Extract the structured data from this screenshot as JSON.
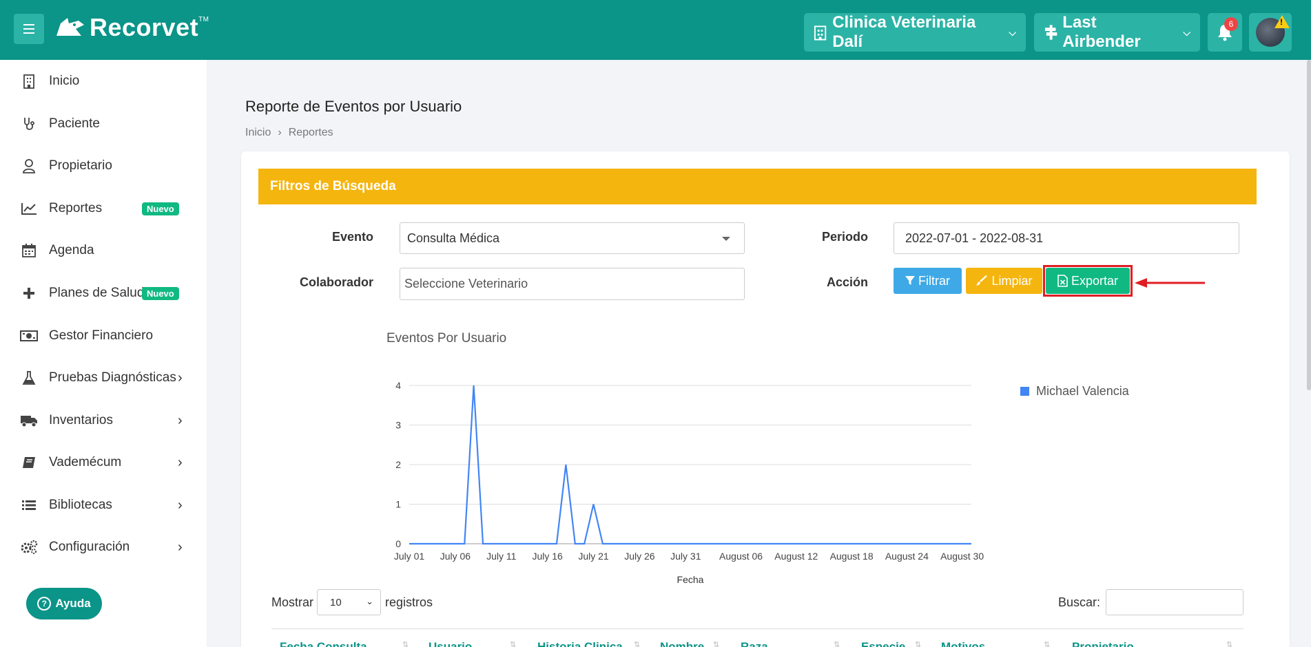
{
  "topbar": {
    "brand": "Recorvet",
    "trademark": "TM",
    "clinic": "Clinica Veterinaria Dalí",
    "user": "Last Airbender",
    "notifications": "6",
    "warning": "!",
    "accent": "#0b9488"
  },
  "sidebar": {
    "items": [
      {
        "label": "Inicio",
        "icon": "building-icon"
      },
      {
        "label": "Paciente",
        "icon": "stethoscope-icon"
      },
      {
        "label": "Propietario",
        "icon": "user-icon"
      },
      {
        "label": "Reportes",
        "icon": "chart-line-icon",
        "badge": "Nuevo"
      },
      {
        "label": "Agenda",
        "icon": "calendar-icon"
      },
      {
        "label": "Planes de Salud",
        "icon": "plus-icon",
        "badge": "Nuevo"
      },
      {
        "label": "Gestor Financiero",
        "icon": "money-icon"
      },
      {
        "label": "Pruebas Diagnósticas",
        "icon": "flask-icon"
      },
      {
        "label": "Inventarios",
        "icon": "truck-icon"
      },
      {
        "label": "Vademécum",
        "icon": "book-icon"
      },
      {
        "label": "Bibliotecas",
        "icon": "list-icon"
      },
      {
        "label": "Configuración",
        "icon": "gears-icon"
      }
    ],
    "help": "Ayuda"
  },
  "page": {
    "title": "Reporte de Eventos por Usuario",
    "breadcrumb": [
      "Inicio",
      "Reportes"
    ],
    "breadcrumb_sep": "›"
  },
  "filters": {
    "header": "Filtros de Búsqueda",
    "evento_label": "Evento",
    "evento_value": "Consulta Médica",
    "colaborador_label": "Colaborador",
    "colaborador_placeholder": "Seleccione Veterinario",
    "periodo_label": "Periodo",
    "periodo_value": "2022-07-01 - 2022-08-31",
    "accion_label": "Acción",
    "filtrar": "Filtrar",
    "limpiar": "Limpiar",
    "exportar": "Exportar",
    "colors": {
      "header": "#f5b50f",
      "filtrar": "#3ea9e6",
      "limpiar": "#f5b50f",
      "exportar": "#10b981"
    }
  },
  "chart_data": {
    "type": "line",
    "title": "Eventos Por Usuario",
    "xlabel": "Fecha",
    "ylabel": "",
    "ylim": [
      0,
      4
    ],
    "yticks": [
      "0",
      "1",
      "2",
      "3",
      "4"
    ],
    "xticks": [
      "July 01",
      "July 06",
      "July 11",
      "July 16",
      "July 21",
      "July 26",
      "July 31",
      "August 06",
      "August 12",
      "August 18",
      "August 24",
      "August 30"
    ],
    "x_start": "2022-07-01",
    "x_end": "2022-08-31",
    "series": [
      {
        "name": "Michael Valencia",
        "color": "#4285f4",
        "points": [
          {
            "x": "2022-07-01",
            "y": 0
          },
          {
            "x": "2022-07-07",
            "y": 0
          },
          {
            "x": "2022-07-08",
            "y": 4
          },
          {
            "x": "2022-07-09",
            "y": 0
          },
          {
            "x": "2022-07-17",
            "y": 0
          },
          {
            "x": "2022-07-18",
            "y": 2
          },
          {
            "x": "2022-07-19",
            "y": 0
          },
          {
            "x": "2022-07-20",
            "y": 0
          },
          {
            "x": "2022-07-21",
            "y": 1
          },
          {
            "x": "2022-07-22",
            "y": 0
          },
          {
            "x": "2022-08-31",
            "y": 0
          }
        ]
      }
    ]
  },
  "table": {
    "show_label": "Mostrar",
    "length_value": "10",
    "records_label": "registros",
    "search_label": "Buscar:",
    "columns": [
      "Fecha Consulta",
      "Usuario",
      "Historia Clinica",
      "Nombre",
      "Raza",
      "Especie",
      "Motivos",
      "Propietario"
    ]
  }
}
